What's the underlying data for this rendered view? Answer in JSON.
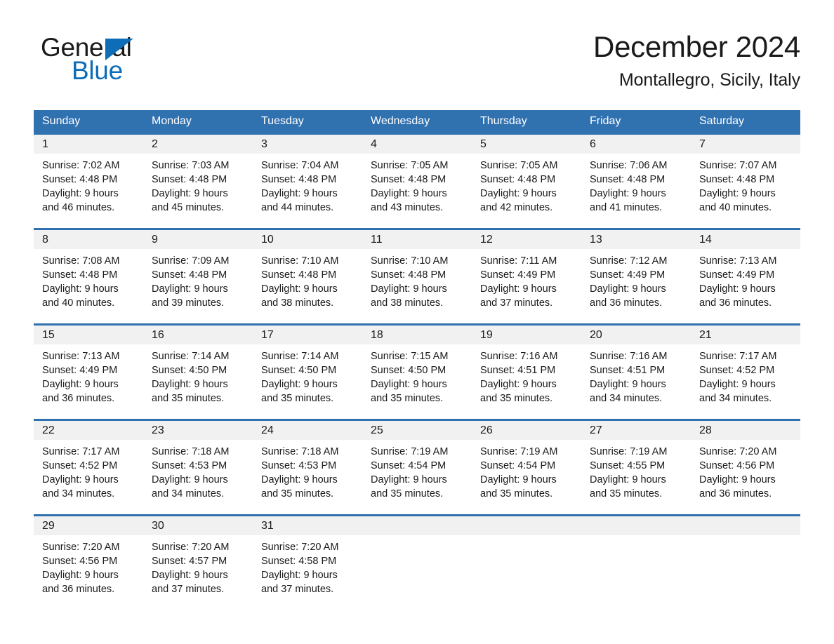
{
  "logo": {
    "word1": "General",
    "word2": "Blue",
    "triangle_color": "#0f6cb6",
    "icon": "triangle-icon"
  },
  "header": {
    "title": "December 2024",
    "subtitle": "Montallegro, Sicily, Italy"
  },
  "colors": {
    "header_blue": "#3071b0",
    "day_band_gray": "#f1f1f1",
    "brand_blue": "#0f6cb6",
    "text": "#1a1a1a"
  },
  "calendar": {
    "weekday_headers": [
      "Sunday",
      "Monday",
      "Tuesday",
      "Wednesday",
      "Thursday",
      "Friday",
      "Saturday"
    ],
    "weeks": [
      [
        {
          "day": "1",
          "sunrise": "Sunrise: 7:02 AM",
          "sunset": "Sunset: 4:48 PM",
          "daylight_line1": "Daylight: 9 hours",
          "daylight_line2": "and 46 minutes."
        },
        {
          "day": "2",
          "sunrise": "Sunrise: 7:03 AM",
          "sunset": "Sunset: 4:48 PM",
          "daylight_line1": "Daylight: 9 hours",
          "daylight_line2": "and 45 minutes."
        },
        {
          "day": "3",
          "sunrise": "Sunrise: 7:04 AM",
          "sunset": "Sunset: 4:48 PM",
          "daylight_line1": "Daylight: 9 hours",
          "daylight_line2": "and 44 minutes."
        },
        {
          "day": "4",
          "sunrise": "Sunrise: 7:05 AM",
          "sunset": "Sunset: 4:48 PM",
          "daylight_line1": "Daylight: 9 hours",
          "daylight_line2": "and 43 minutes."
        },
        {
          "day": "5",
          "sunrise": "Sunrise: 7:05 AM",
          "sunset": "Sunset: 4:48 PM",
          "daylight_line1": "Daylight: 9 hours",
          "daylight_line2": "and 42 minutes."
        },
        {
          "day": "6",
          "sunrise": "Sunrise: 7:06 AM",
          "sunset": "Sunset: 4:48 PM",
          "daylight_line1": "Daylight: 9 hours",
          "daylight_line2": "and 41 minutes."
        },
        {
          "day": "7",
          "sunrise": "Sunrise: 7:07 AM",
          "sunset": "Sunset: 4:48 PM",
          "daylight_line1": "Daylight: 9 hours",
          "daylight_line2": "and 40 minutes."
        }
      ],
      [
        {
          "day": "8",
          "sunrise": "Sunrise: 7:08 AM",
          "sunset": "Sunset: 4:48 PM",
          "daylight_line1": "Daylight: 9 hours",
          "daylight_line2": "and 40 minutes."
        },
        {
          "day": "9",
          "sunrise": "Sunrise: 7:09 AM",
          "sunset": "Sunset: 4:48 PM",
          "daylight_line1": "Daylight: 9 hours",
          "daylight_line2": "and 39 minutes."
        },
        {
          "day": "10",
          "sunrise": "Sunrise: 7:10 AM",
          "sunset": "Sunset: 4:48 PM",
          "daylight_line1": "Daylight: 9 hours",
          "daylight_line2": "and 38 minutes."
        },
        {
          "day": "11",
          "sunrise": "Sunrise: 7:10 AM",
          "sunset": "Sunset: 4:48 PM",
          "daylight_line1": "Daylight: 9 hours",
          "daylight_line2": "and 38 minutes."
        },
        {
          "day": "12",
          "sunrise": "Sunrise: 7:11 AM",
          "sunset": "Sunset: 4:49 PM",
          "daylight_line1": "Daylight: 9 hours",
          "daylight_line2": "and 37 minutes."
        },
        {
          "day": "13",
          "sunrise": "Sunrise: 7:12 AM",
          "sunset": "Sunset: 4:49 PM",
          "daylight_line1": "Daylight: 9 hours",
          "daylight_line2": "and 36 minutes."
        },
        {
          "day": "14",
          "sunrise": "Sunrise: 7:13 AM",
          "sunset": "Sunset: 4:49 PM",
          "daylight_line1": "Daylight: 9 hours",
          "daylight_line2": "and 36 minutes."
        }
      ],
      [
        {
          "day": "15",
          "sunrise": "Sunrise: 7:13 AM",
          "sunset": "Sunset: 4:49 PM",
          "daylight_line1": "Daylight: 9 hours",
          "daylight_line2": "and 36 minutes."
        },
        {
          "day": "16",
          "sunrise": "Sunrise: 7:14 AM",
          "sunset": "Sunset: 4:50 PM",
          "daylight_line1": "Daylight: 9 hours",
          "daylight_line2": "and 35 minutes."
        },
        {
          "day": "17",
          "sunrise": "Sunrise: 7:14 AM",
          "sunset": "Sunset: 4:50 PM",
          "daylight_line1": "Daylight: 9 hours",
          "daylight_line2": "and 35 minutes."
        },
        {
          "day": "18",
          "sunrise": "Sunrise: 7:15 AM",
          "sunset": "Sunset: 4:50 PM",
          "daylight_line1": "Daylight: 9 hours",
          "daylight_line2": "and 35 minutes."
        },
        {
          "day": "19",
          "sunrise": "Sunrise: 7:16 AM",
          "sunset": "Sunset: 4:51 PM",
          "daylight_line1": "Daylight: 9 hours",
          "daylight_line2": "and 35 minutes."
        },
        {
          "day": "20",
          "sunrise": "Sunrise: 7:16 AM",
          "sunset": "Sunset: 4:51 PM",
          "daylight_line1": "Daylight: 9 hours",
          "daylight_line2": "and 34 minutes."
        },
        {
          "day": "21",
          "sunrise": "Sunrise: 7:17 AM",
          "sunset": "Sunset: 4:52 PM",
          "daylight_line1": "Daylight: 9 hours",
          "daylight_line2": "and 34 minutes."
        }
      ],
      [
        {
          "day": "22",
          "sunrise": "Sunrise: 7:17 AM",
          "sunset": "Sunset: 4:52 PM",
          "daylight_line1": "Daylight: 9 hours",
          "daylight_line2": "and 34 minutes."
        },
        {
          "day": "23",
          "sunrise": "Sunrise: 7:18 AM",
          "sunset": "Sunset: 4:53 PM",
          "daylight_line1": "Daylight: 9 hours",
          "daylight_line2": "and 34 minutes."
        },
        {
          "day": "24",
          "sunrise": "Sunrise: 7:18 AM",
          "sunset": "Sunset: 4:53 PM",
          "daylight_line1": "Daylight: 9 hours",
          "daylight_line2": "and 35 minutes."
        },
        {
          "day": "25",
          "sunrise": "Sunrise: 7:19 AM",
          "sunset": "Sunset: 4:54 PM",
          "daylight_line1": "Daylight: 9 hours",
          "daylight_line2": "and 35 minutes."
        },
        {
          "day": "26",
          "sunrise": "Sunrise: 7:19 AM",
          "sunset": "Sunset: 4:54 PM",
          "daylight_line1": "Daylight: 9 hours",
          "daylight_line2": "and 35 minutes."
        },
        {
          "day": "27",
          "sunrise": "Sunrise: 7:19 AM",
          "sunset": "Sunset: 4:55 PM",
          "daylight_line1": "Daylight: 9 hours",
          "daylight_line2": "and 35 minutes."
        },
        {
          "day": "28",
          "sunrise": "Sunrise: 7:20 AM",
          "sunset": "Sunset: 4:56 PM",
          "daylight_line1": "Daylight: 9 hours",
          "daylight_line2": "and 36 minutes."
        }
      ],
      [
        {
          "day": "29",
          "sunrise": "Sunrise: 7:20 AM",
          "sunset": "Sunset: 4:56 PM",
          "daylight_line1": "Daylight: 9 hours",
          "daylight_line2": "and 36 minutes."
        },
        {
          "day": "30",
          "sunrise": "Sunrise: 7:20 AM",
          "sunset": "Sunset: 4:57 PM",
          "daylight_line1": "Daylight: 9 hours",
          "daylight_line2": "and 37 minutes."
        },
        {
          "day": "31",
          "sunrise": "Sunrise: 7:20 AM",
          "sunset": "Sunset: 4:58 PM",
          "daylight_line1": "Daylight: 9 hours",
          "daylight_line2": "and 37 minutes."
        },
        {
          "day": "",
          "sunrise": "",
          "sunset": "",
          "daylight_line1": "",
          "daylight_line2": ""
        },
        {
          "day": "",
          "sunrise": "",
          "sunset": "",
          "daylight_line1": "",
          "daylight_line2": ""
        },
        {
          "day": "",
          "sunrise": "",
          "sunset": "",
          "daylight_line1": "",
          "daylight_line2": ""
        },
        {
          "day": "",
          "sunrise": "",
          "sunset": "",
          "daylight_line1": "",
          "daylight_line2": ""
        }
      ]
    ]
  }
}
